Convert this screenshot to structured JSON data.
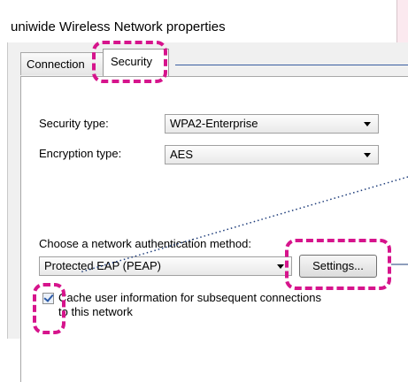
{
  "window": {
    "title": "uniwide Wireless Network properties"
  },
  "tabs": {
    "connection": "Connection",
    "security": "Security"
  },
  "security_type": {
    "label": "Security type:",
    "value": "WPA2-Enterprise"
  },
  "encryption_type": {
    "label": "Encryption type:",
    "value": "AES"
  },
  "auth_method": {
    "label": "Choose a network authentication method:",
    "value": "Protected EAP (PEAP)",
    "settings_button": "Settings..."
  },
  "cache_option": {
    "line1": "Cache user information for subsequent connections",
    "line2": "to this network",
    "checked": true
  },
  "colors": {
    "highlight": "#d6148c",
    "connector": "#1d3c7a"
  }
}
